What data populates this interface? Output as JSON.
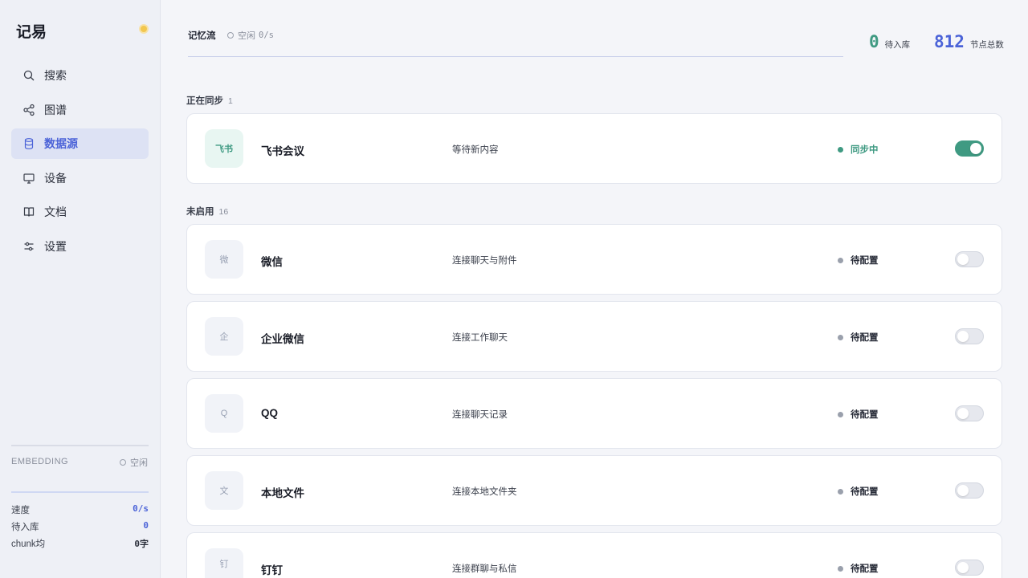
{
  "app": {
    "title": "记易"
  },
  "sidebar": {
    "items": [
      {
        "label": "搜索",
        "icon": "search-icon"
      },
      {
        "label": "图谱",
        "icon": "share-icon"
      },
      {
        "label": "数据源",
        "icon": "database-icon",
        "active": true
      },
      {
        "label": "设备",
        "icon": "monitor-icon"
      },
      {
        "label": "文档",
        "icon": "book-icon"
      },
      {
        "label": "设置",
        "icon": "sliders-icon"
      }
    ],
    "embedding": {
      "label": "EMBEDDING",
      "status": "空闲"
    },
    "stats": [
      {
        "label": "速度",
        "value": "0/s"
      },
      {
        "label": "待入库",
        "value": "0"
      },
      {
        "label": "chunk均",
        "value": "0字"
      }
    ]
  },
  "header": {
    "title": "记忆流",
    "status_label": "空闲",
    "status_rate": "0/s",
    "pending": {
      "value": "0",
      "label": "待入库"
    },
    "nodes": {
      "value": "812",
      "label": "节点总数"
    }
  },
  "sections": {
    "syncing": {
      "title": "正在同步",
      "count": "1"
    },
    "disabled": {
      "title": "未启用",
      "count": "16"
    }
  },
  "sources": [
    {
      "badge": "飞书",
      "name": "飞书会议",
      "desc": "等待新内容",
      "status": "同步中",
      "enabled": true
    },
    {
      "badge": "微",
      "name": "微信",
      "desc": "连接聊天与附件",
      "status": "待配置",
      "enabled": false
    },
    {
      "badge": "企",
      "name": "企业微信",
      "desc": "连接工作聊天",
      "status": "待配置",
      "enabled": false
    },
    {
      "badge": "Q",
      "name": "QQ",
      "desc": "连接聊天记录",
      "status": "待配置",
      "enabled": false
    },
    {
      "badge": "文",
      "name": "本地文件",
      "desc": "连接本地文件夹",
      "status": "待配置",
      "enabled": false
    },
    {
      "badge": "钉",
      "name": "钉钉",
      "desc": "连接群聊与私信",
      "status": "待配置",
      "enabled": false
    }
  ],
  "colors": {
    "accent": "#4b63d8",
    "success": "#3f9a82",
    "muted": "#9aa0ac"
  }
}
